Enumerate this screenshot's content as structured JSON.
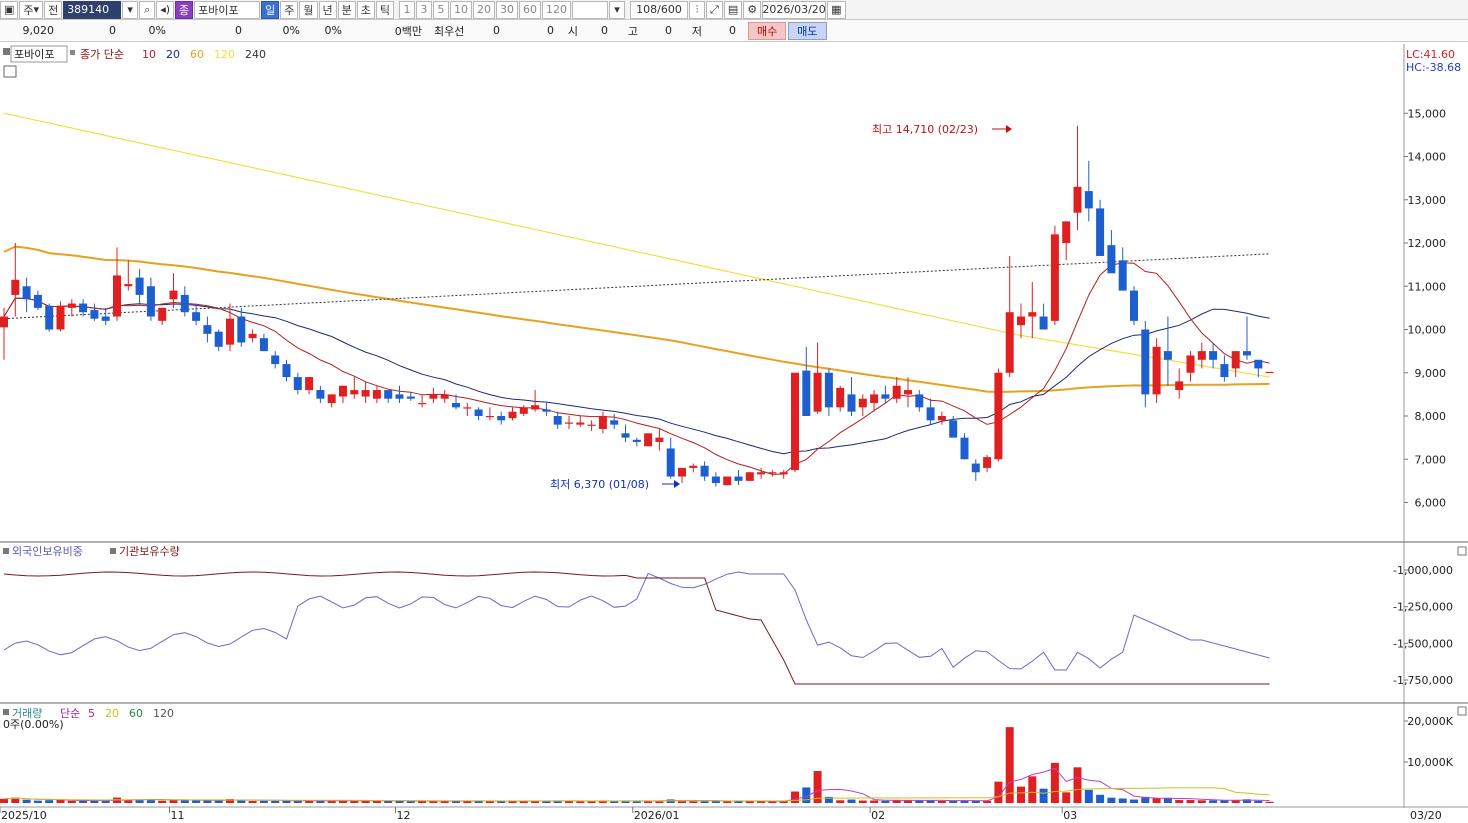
{
  "toolbar": {
    "market": "주",
    "type_label": "전",
    "code": "389140",
    "name_badge": "종",
    "name": "포바이포",
    "periods": [
      "일",
      "주",
      "월",
      "년",
      "분",
      "초",
      "틱"
    ],
    "intervals": [
      "1",
      "3",
      "5",
      "10",
      "20",
      "30",
      "60",
      "120"
    ],
    "count": "108/600",
    "date": "2026/03/20"
  },
  "infobar": {
    "price": "9,020",
    "change": "0",
    "change_pct": "0%",
    "volume": "0",
    "vol_pct1": "0%",
    "vol_pct2": "0%",
    "amount": "0백만",
    "best_quote_label": "최우선",
    "best_ask": "0",
    "best_bid": "0",
    "open_label": "시",
    "open": "0",
    "high_label": "고",
    "high": "0",
    "low_label": "저",
    "low": "0",
    "buy": "매수",
    "sell": "매도"
  },
  "price_panel": {
    "stock_name": "포바이포",
    "ma_title": "종가 단순",
    "ma_periods": [
      "10",
      "20",
      "60",
      "120",
      "240"
    ],
    "ma_colors": [
      "#b02020",
      "#1a2a7a",
      "#e8a020",
      "#f0e040",
      "#333333"
    ],
    "lc": "LC:41.60",
    "hc": "HC:-38.68",
    "y_ticks": [
      "15,000",
      "14,000",
      "13,000",
      "12,000",
      "11,000",
      "10,000",
      "9,000",
      "8,000",
      "7,000",
      "6,000"
    ],
    "high_note": "최고 14,710 (02/23)",
    "low_note": "최저 6,370 (01/08)"
  },
  "holding_panel": {
    "title1": "외국인보유비중",
    "title2": "기관보유수량",
    "y_ticks": [
      "-1,000,000",
      "-1,250,000",
      "-1,500,000",
      "-1,750,000"
    ]
  },
  "volume_panel": {
    "title": "거래량",
    "ma_title": "단순",
    "ma_periods": [
      "5",
      "20",
      "60",
      "120"
    ],
    "sub": "0주(0.00%)",
    "y_ticks": [
      "20,000K",
      "10,000K"
    ]
  },
  "x_axis": {
    "labels": [
      "2025/10",
      "11",
      "12",
      "2026/01",
      "02",
      "03"
    ],
    "right_label": "03/20"
  },
  "colors": {
    "up": "#e02020",
    "down": "#1e5fd0",
    "foreign": "#6a6ac8",
    "institution": "#7a1a1a"
  },
  "chart_data": {
    "type": "candlestick",
    "candles": [
      [
        10050,
        10500,
        9300,
        10300
      ],
      [
        10800,
        12000,
        10300,
        11150
      ],
      [
        11000,
        11200,
        10400,
        10700
      ],
      [
        10800,
        10900,
        10450,
        10500
      ],
      [
        10550,
        10600,
        9950,
        10000
      ],
      [
        10000,
        10650,
        9950,
        10550
      ],
      [
        10500,
        10700,
        10300,
        10600
      ],
      [
        10600,
        10700,
        10300,
        10400
      ],
      [
        10450,
        10600,
        10200,
        10250
      ],
      [
        10300,
        10500,
        10100,
        10200
      ],
      [
        10300,
        11900,
        10200,
        11250
      ],
      [
        11000,
        11600,
        10900,
        11050
      ],
      [
        11200,
        11400,
        10600,
        10800
      ],
      [
        11000,
        11200,
        10200,
        10300
      ],
      [
        10200,
        10500,
        10100,
        10500
      ],
      [
        10700,
        11300,
        10500,
        10900
      ],
      [
        10800,
        11000,
        10300,
        10400
      ],
      [
        10400,
        10600,
        10100,
        10200
      ],
      [
        10100,
        10300,
        9700,
        9900
      ],
      [
        9950,
        10000,
        9500,
        9600
      ],
      [
        9650,
        10600,
        9500,
        10250
      ],
      [
        10300,
        10500,
        9600,
        9700
      ],
      [
        9800,
        10000,
        9700,
        9900
      ],
      [
        9800,
        9900,
        9500,
        9500
      ],
      [
        9400,
        9500,
        9100,
        9200
      ],
      [
        9200,
        9300,
        8800,
        8900
      ],
      [
        8900,
        9000,
        8500,
        8600
      ],
      [
        8600,
        8900,
        8500,
        8900
      ],
      [
        8600,
        8700,
        8300,
        8400
      ],
      [
        8300,
        8500,
        8200,
        8500
      ],
      [
        8450,
        8700,
        8300,
        8700
      ],
      [
        8500,
        8900,
        8400,
        8600
      ],
      [
        8450,
        8800,
        8300,
        8600
      ],
      [
        8400,
        8700,
        8300,
        8600
      ],
      [
        8600,
        8600,
        8300,
        8400
      ],
      [
        8500,
        8700,
        8300,
        8400
      ],
      [
        8450,
        8550,
        8350,
        8400
      ],
      [
        8300,
        8500,
        8200,
        8300
      ],
      [
        8400,
        8650,
        8300,
        8500
      ],
      [
        8400,
        8600,
        8300,
        8500
      ],
      [
        8300,
        8500,
        8150,
        8200
      ],
      [
        8200,
        8300,
        8000,
        8200
      ],
      [
        8150,
        8200,
        7900,
        8000
      ],
      [
        8000,
        8200,
        7900,
        8000
      ],
      [
        8000,
        8100,
        7800,
        7900
      ],
      [
        7950,
        8200,
        7900,
        8100
      ],
      [
        8050,
        8250,
        8000,
        8200
      ],
      [
        8150,
        8600,
        8100,
        8250
      ],
      [
        8150,
        8300,
        8000,
        8100
      ],
      [
        8000,
        8100,
        7700,
        7800
      ],
      [
        7850,
        8000,
        7700,
        7850
      ],
      [
        7800,
        8000,
        7750,
        7850
      ],
      [
        7800,
        7900,
        7650,
        7800
      ],
      [
        7700,
        8100,
        7600,
        8000
      ],
      [
        7900,
        8050,
        7700,
        7800
      ],
      [
        7600,
        7800,
        7400,
        7500
      ],
      [
        7450,
        7500,
        7300,
        7400
      ],
      [
        7300,
        7600,
        7300,
        7600
      ],
      [
        7400,
        7700,
        7200,
        7500
      ],
      [
        7250,
        7500,
        6550,
        6600
      ],
      [
        6600,
        6800,
        6450,
        6800
      ],
      [
        6800,
        6900,
        6700,
        6850
      ],
      [
        6850,
        6950,
        6500,
        6600
      ],
      [
        6600,
        6700,
        6370,
        6450
      ],
      [
        6400,
        6600,
        6400,
        6600
      ],
      [
        6600,
        6750,
        6400,
        6500
      ],
      [
        6500,
        6700,
        6500,
        6700
      ],
      [
        6650,
        6800,
        6550,
        6700
      ],
      [
        6700,
        6750,
        6600,
        6700
      ],
      [
        6650,
        6750,
        6550,
        6700
      ],
      [
        6750,
        9000,
        6700,
        9000
      ],
      [
        9050,
        9600,
        8000,
        8000
      ],
      [
        8100,
        9700,
        8050,
        9000
      ],
      [
        9000,
        9100,
        8000,
        8200
      ],
      [
        8200,
        8700,
        8100,
        8650
      ],
      [
        8500,
        8900,
        8000,
        8100
      ],
      [
        8200,
        8500,
        8000,
        8400
      ],
      [
        8300,
        8600,
        8100,
        8500
      ],
      [
        8500,
        8700,
        8300,
        8400
      ],
      [
        8400,
        8900,
        8300,
        8700
      ],
      [
        8500,
        8900,
        8200,
        8600
      ],
      [
        8500,
        8600,
        8100,
        8200
      ],
      [
        8200,
        8400,
        7800,
        7900
      ],
      [
        7900,
        8100,
        7800,
        8000
      ],
      [
        7900,
        8000,
        7700,
        7500
      ],
      [
        7500,
        7600,
        7000,
        7000
      ],
      [
        6900,
        7000,
        6500,
        6700
      ],
      [
        6800,
        7100,
        6700,
        7050
      ],
      [
        7000,
        9100,
        6950,
        9000
      ],
      [
        9000,
        11700,
        8900,
        10400
      ],
      [
        10100,
        10600,
        9800,
        10300
      ],
      [
        10300,
        11100,
        9800,
        10400
      ],
      [
        10300,
        10600,
        10000,
        10000
      ],
      [
        10200,
        12400,
        10100,
        12200
      ],
      [
        12000,
        12300,
        11600,
        12500
      ],
      [
        12700,
        14710,
        12300,
        13300
      ],
      [
        13200,
        13900,
        12500,
        12800
      ],
      [
        12800,
        13000,
        11700,
        11700
      ],
      [
        11950,
        12300,
        11500,
        11300
      ],
      [
        11600,
        11900,
        10900,
        10900
      ],
      [
        10900,
        11000,
        10100,
        10200
      ],
      [
        10000,
        10200,
        8200,
        8500
      ],
      [
        8500,
        9800,
        8300,
        9600
      ],
      [
        9500,
        10300,
        8700,
        9300
      ],
      [
        8600,
        9100,
        8400,
        8800
      ],
      [
        9000,
        9500,
        8800,
        9400
      ],
      [
        9300,
        9700,
        9100,
        9500
      ],
      [
        9500,
        9700,
        9100,
        9300
      ],
      [
        9200,
        9400,
        8800,
        8900
      ],
      [
        9100,
        9500,
        8900,
        9500
      ],
      [
        9500,
        10300,
        9300,
        9400
      ],
      [
        9300,
        9300,
        8900,
        9100
      ],
      [
        9020,
        9020,
        9020,
        9020
      ]
    ]
  }
}
